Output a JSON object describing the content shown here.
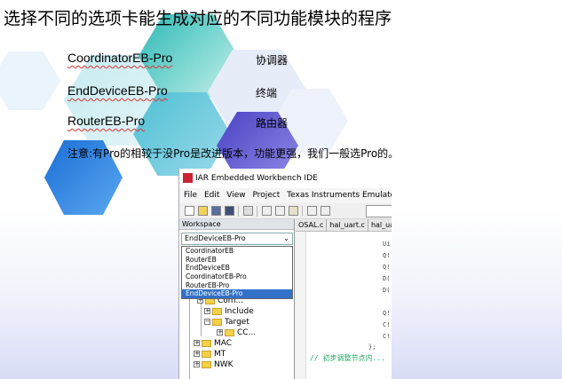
{
  "slide": {
    "title": "选择不同的选项卡能生成对应的不同功能模块的程序",
    "rows": [
      {
        "label": "CoordinatorEB-Pro",
        "desc": "协调器"
      },
      {
        "label": "EndDeviceEB-Pro",
        "desc": "终端"
      },
      {
        "label": "RouterEB-Pro",
        "desc": "路由器"
      }
    ],
    "note": "注意:有Pro的相较于没Pro是改进版本，功能更强，我们一般选Pro的。"
  },
  "colors": {
    "hex_teal": "#4ec5c5",
    "hex_blue": "#2f8fe0",
    "hex_violet": "#6f66d6",
    "hex_pale": "#dde6f6",
    "selection": "#3271c8"
  },
  "ide": {
    "title": "IAR Embedded Workbench IDE",
    "menu": [
      "File",
      "Edit",
      "View",
      "Project",
      "Texas Instruments Emulator"
    ],
    "toolbar_icons": [
      "new-file-icon",
      "open-folder-icon",
      "save-icon",
      "save-all-icon",
      "print-icon",
      "cut-icon",
      "copy-icon",
      "paste-icon",
      "undo-icon",
      "redo-icon"
    ],
    "workspace": {
      "header": "Workspace",
      "selected_config": "EndDeviceEB-Pro",
      "options": [
        "CoordinatorEB",
        "RouterEB",
        "EndDeviceEB",
        "CoordinatorEB-Pro",
        "RouterEB-Pro",
        "EndDeviceEB-Pro"
      ],
      "highlighted_option": "EndDeviceEB-Pro",
      "tree": [
        "Com...",
        "Include",
        "Target",
        "CC...",
        "MAC",
        "MT",
        "NWK"
      ]
    },
    "editor": {
      "tabs": [
        "OSAL.c",
        "hal_uart.c",
        "hal_uart..."
      ],
      "code_fragments": [
        "Ui",
        "Q!",
        "Q!",
        "D(",
        "D(",
        "Q!",
        "C!",
        "C!"
      ],
      "closing_brace": "};",
      "comment": "// 初步调整节点内..."
    }
  }
}
